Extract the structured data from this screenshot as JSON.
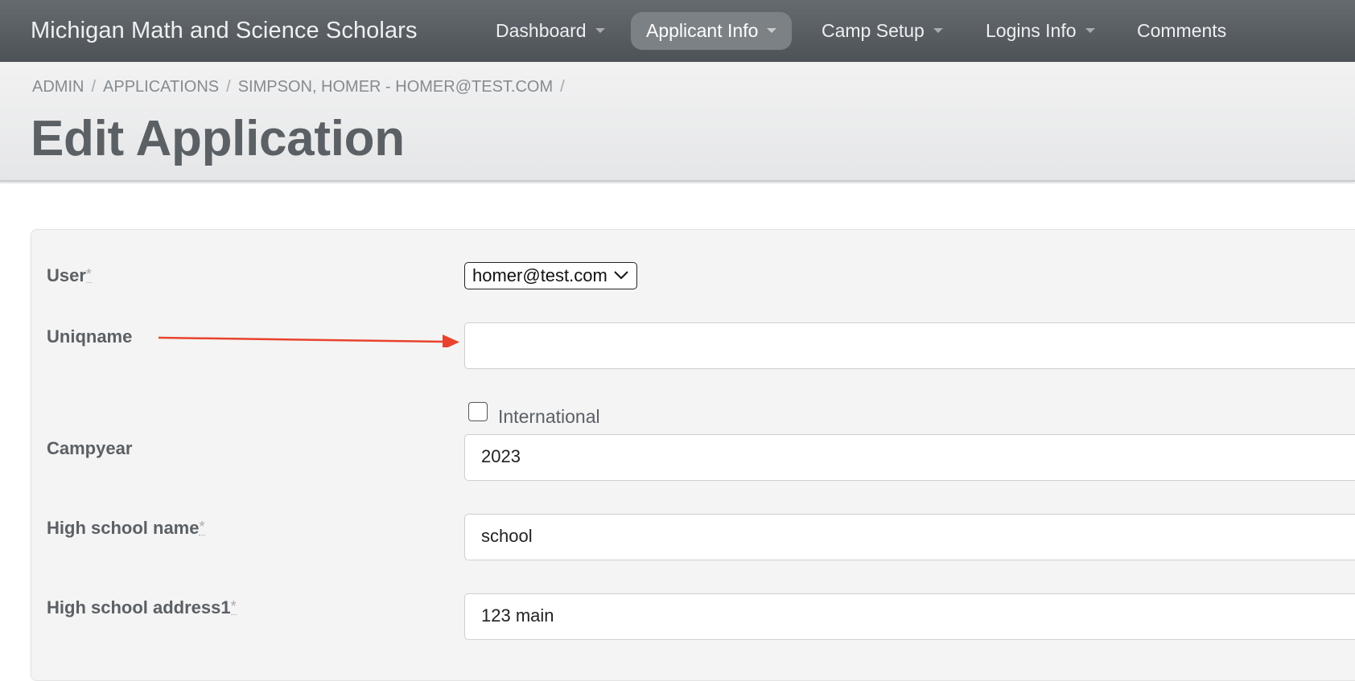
{
  "navbar": {
    "brand": "Michigan Math and Science Scholars",
    "items": [
      {
        "label": "Dashboard",
        "has_caret": true
      },
      {
        "label": "Applicant Info",
        "has_caret": true,
        "active": true
      },
      {
        "label": "Camp Setup",
        "has_caret": true
      },
      {
        "label": "Logins Info",
        "has_caret": true
      },
      {
        "label": "Comments",
        "has_caret": false
      }
    ]
  },
  "breadcrumb": [
    "ADMIN",
    "APPLICATIONS",
    "SIMPSON, HOMER - HOMER@TEST.COM"
  ],
  "breadcrumb_separator": "/",
  "page_title": "Edit Application",
  "form": {
    "required_marker": "*",
    "user": {
      "label": "User",
      "value": "homer@test.com"
    },
    "uniqname": {
      "label": "Uniqname",
      "value": ""
    },
    "international": {
      "label": "International",
      "checked": false
    },
    "campyear": {
      "label": "Campyear",
      "value": "2023"
    },
    "high_school_name": {
      "label": "High school name",
      "value": "school"
    },
    "high_school_address1": {
      "label": "High school address1",
      "value": "123 main"
    }
  },
  "annotation": {
    "type": "arrow",
    "color": "#e8432e",
    "points_to": "uniqname-input"
  }
}
